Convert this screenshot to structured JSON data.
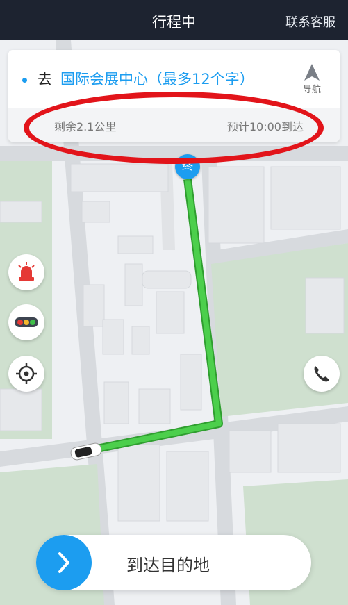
{
  "header": {
    "title": "行程中",
    "service_label": "联系客服"
  },
  "trip": {
    "go_prefix": "去",
    "destination": "国际会展中心（最多12个字）",
    "nav_label": "导航",
    "remaining": "剩余2.1公里",
    "eta": "预计10:00到达"
  },
  "map": {
    "end_marker": "终"
  },
  "action": {
    "arrive_label": "到达目的地"
  },
  "colors": {
    "accent": "#1c9df0",
    "route": "#4ccf4c",
    "header_bg": "#1d2330",
    "highlight": "#e2141a"
  },
  "icons": [
    "navigation-arrow-icon",
    "alarm-light-icon",
    "traffic-light-icon",
    "locate-icon",
    "phone-icon",
    "chevron-right-icon",
    "car-icon"
  ]
}
